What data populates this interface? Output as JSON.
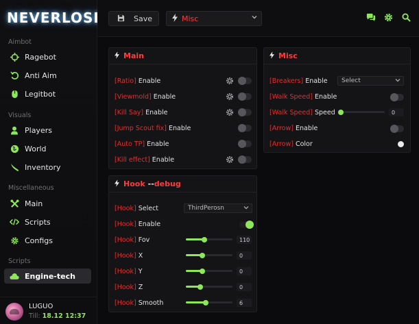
{
  "app": {
    "logo": "NEVERLOSE"
  },
  "sidebar": {
    "sections": [
      {
        "title": "Aimbot",
        "items": [
          {
            "label": "Ragebot",
            "icon": "crosshair-icon"
          },
          {
            "label": "Anti Aim",
            "icon": "rotate-icon"
          },
          {
            "label": "Legitbot",
            "icon": "mouse-icon"
          }
        ]
      },
      {
        "title": "Visuals",
        "items": [
          {
            "label": "Players",
            "icon": "user-icon"
          },
          {
            "label": "World",
            "icon": "globe-icon"
          },
          {
            "label": "Inventory",
            "icon": "knife-icon"
          }
        ]
      },
      {
        "title": "Miscellaneous",
        "items": [
          {
            "label": "Main",
            "icon": "tools-icon"
          },
          {
            "label": "Scripts",
            "icon": "code-icon"
          },
          {
            "label": "Configs",
            "icon": "gear-icon"
          }
        ]
      },
      {
        "title": "Scripts",
        "items": [
          {
            "label": "Engine-tech",
            "icon": "cloud-icon",
            "active": true
          }
        ]
      }
    ]
  },
  "user": {
    "name": "LUGUO",
    "till_label": "Till:",
    "till_date": "18.12 12:37"
  },
  "toolbar": {
    "save_label": "Save",
    "category": "Misc"
  },
  "panels": {
    "main": {
      "title": "Main",
      "rows": [
        {
          "tag": "[Ratio]",
          "label": "Enable",
          "gear": true,
          "on": false
        },
        {
          "tag": "[Viewmold]",
          "label": "Enable",
          "gear": true,
          "on": false
        },
        {
          "tag": "[Kill Say]",
          "label": "Enable",
          "gear": true,
          "on": false
        },
        {
          "tag": "[Jump Scout fix]",
          "label": "Enable",
          "gear": false,
          "on": false
        },
        {
          "tag": "[Auto TP]",
          "label": "Enable",
          "gear": false,
          "on": false
        },
        {
          "tag": "[Kill effect]",
          "label": "Enable",
          "gear": true,
          "on": false
        }
      ]
    },
    "misc": {
      "title": "Misc",
      "breakers": {
        "tag": "[Breakers]",
        "label": "Enable",
        "value": "Select"
      },
      "walk_enable": {
        "tag": "[Walk Speed]",
        "label": "Enable",
        "on": false
      },
      "walk_speed": {
        "tag": "[Walk Speed]",
        "label": "Speed",
        "value": "0",
        "fraction": 0.0
      },
      "arrow_enable": {
        "tag": "[Arrow]",
        "label": "Enable",
        "on": false
      },
      "arrow_color": {
        "tag": "[Arrow]",
        "label": "Color"
      }
    },
    "hook": {
      "title": "Hook",
      "title_suffix": "--",
      "title_debug": "debug",
      "select": {
        "tag": "[Hook]",
        "label": "Select",
        "value": "ThirdPerosn"
      },
      "enable": {
        "tag": "[Hook]",
        "label": "Enable",
        "on": true
      },
      "sliders": [
        {
          "tag": "[Hook]",
          "label": "Fov",
          "value": "110",
          "fraction": 0.4
        },
        {
          "tag": "[Hook]",
          "label": "X",
          "value": "0",
          "fraction": 0.35
        },
        {
          "tag": "[Hook]",
          "label": "Y",
          "value": "0",
          "fraction": 0.35
        },
        {
          "tag": "[Hook]",
          "label": "Z",
          "value": "0",
          "fraction": 0.31
        },
        {
          "tag": "[Hook]",
          "label": "Smooth",
          "value": "6",
          "fraction": 0.43
        }
      ]
    }
  },
  "colors": {
    "accent": "#8ee65a",
    "tag_red": "#e0302f",
    "title_red": "#ff3b3b"
  }
}
